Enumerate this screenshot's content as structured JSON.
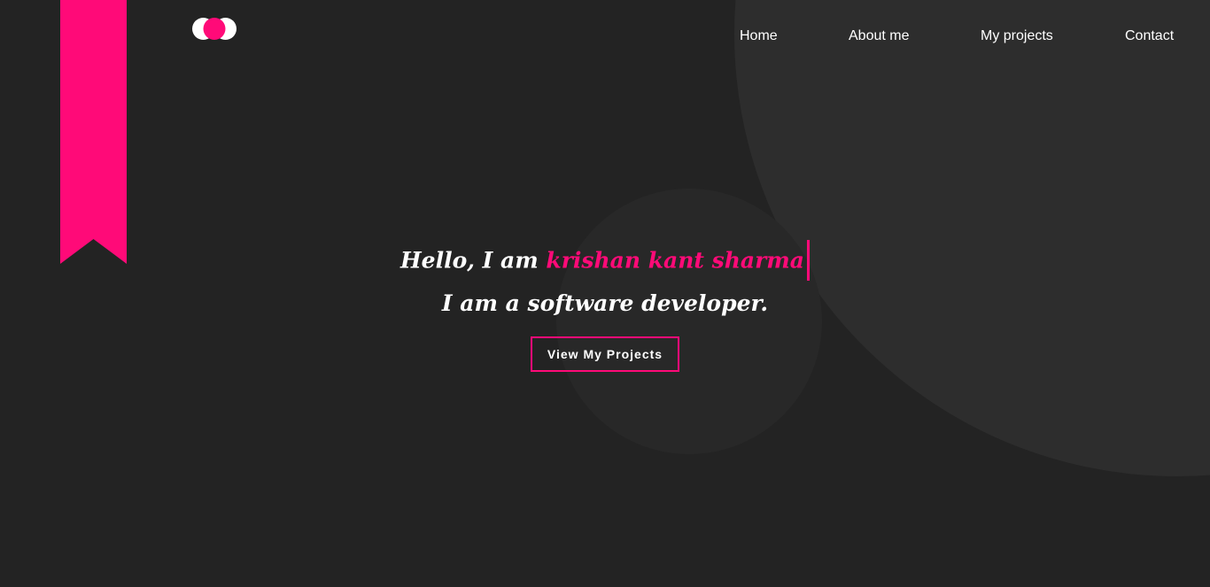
{
  "colors": {
    "background": "#232323",
    "circle_large": "#2d2d2d",
    "circle_small": "#282828",
    "accent": "#ff0a78",
    "text": "#ffffff"
  },
  "logo": {
    "icon": "two-circles-logo-icon"
  },
  "ribbon": {
    "icon": "bookmark-ribbon-icon"
  },
  "nav": {
    "items": [
      {
        "label": "Home"
      },
      {
        "label": "About me"
      },
      {
        "label": "My projects"
      },
      {
        "label": "Contact"
      }
    ]
  },
  "hero": {
    "greeting": "Hello, I am ",
    "name": "krishan kant sharma",
    "subtitle": "I am a software developer.",
    "cta_label": "View My Projects"
  }
}
